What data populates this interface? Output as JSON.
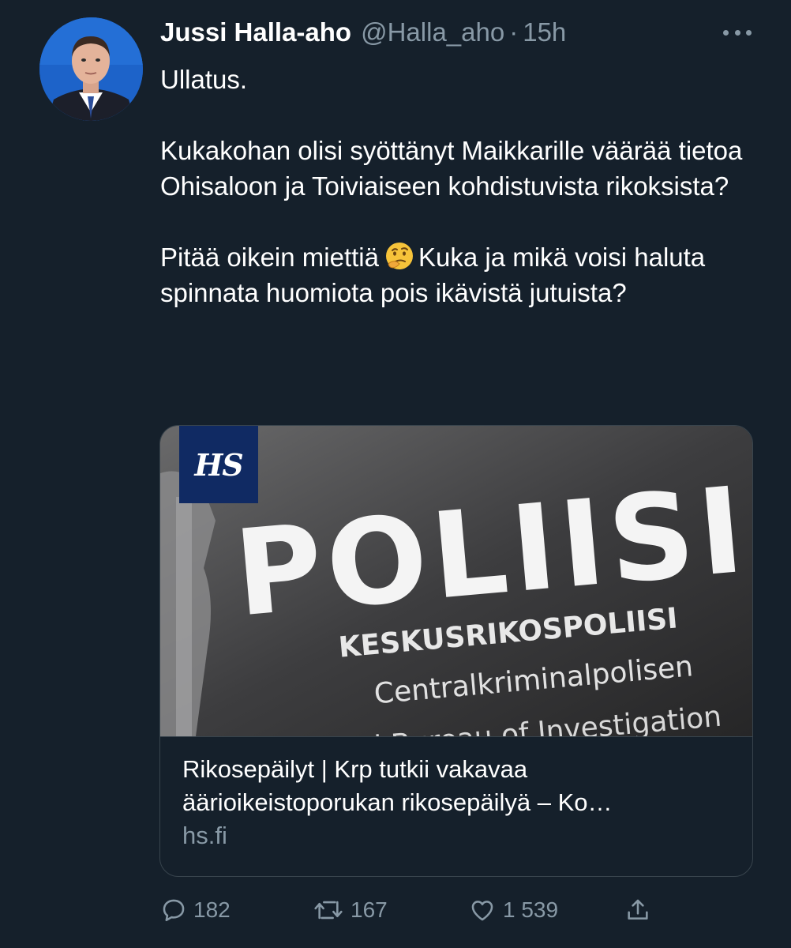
{
  "author": {
    "display_name": "Jussi Halla-aho",
    "handle": "@Halla_aho",
    "separator": "·",
    "time": "15h"
  },
  "icons": {
    "more": "more-horizontal-icon",
    "reply": "reply-bubble-icon",
    "retweet": "retweet-arrows-icon",
    "like": "heart-icon",
    "share": "share-upload-icon",
    "thinking": "thinking-face-emoji"
  },
  "tweet": {
    "line1": "Ullatus.",
    "line2": "Kukakohan olisi syöttänyt Maikkarille väärää tietoa Ohisaloon ja Toiviaiseen kohdistuvista rikoksista?",
    "line3_before": "Pitää oikein miettiä",
    "line3_after": "Kuka ja mikä voisi haluta spinnata huomiota pois ikävistä jutuista?"
  },
  "card": {
    "badge": "HS",
    "sign_main": "POLIISI",
    "sign_line1": "KESKUSRIKOSPOLIISI",
    "sign_line2": "Centralkriminalpolisen",
    "sign_line3": "National Bureau of Investigation",
    "title": "Rikosepäilyt | Krp tutkii vakavaa äärioikeistoporukan rikosepäilyä – Ko…",
    "domain": "hs.fi"
  },
  "stats": {
    "replies": "182",
    "retweets": "167",
    "likes": "1 539"
  },
  "colors": {
    "background": "#15202b",
    "secondary_text": "#8899a6",
    "border": "#38444d",
    "hs_badge": "#102a63"
  }
}
